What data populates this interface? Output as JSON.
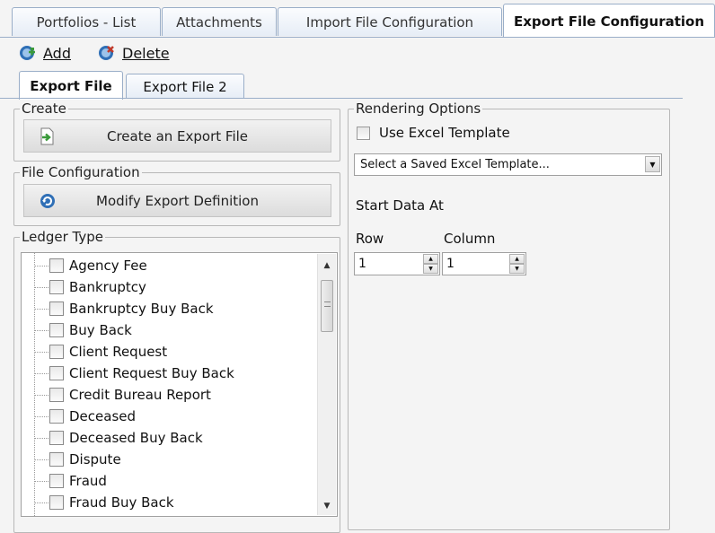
{
  "top_tabs": [
    {
      "label": "Portfolios - List"
    },
    {
      "label": "Attachments"
    },
    {
      "label": "Import File Configuration"
    },
    {
      "label": "Export File Configuration"
    }
  ],
  "toolbar": {
    "add_label": "Add",
    "delete_label": "Delete"
  },
  "sub_tabs": [
    {
      "label": "Export File"
    },
    {
      "label": "Export File 2"
    }
  ],
  "create": {
    "title": "Create",
    "button_label": "Create an Export File"
  },
  "file_configuration": {
    "title": "File Configuration",
    "button_label": "Modify Export Definition"
  },
  "ledger_type": {
    "title": "Ledger Type",
    "items": [
      "Agency Fee",
      "Bankruptcy",
      "Bankruptcy Buy Back",
      "Buy Back",
      "Client Request",
      "Client Request Buy Back",
      "Credit Bureau Report",
      "Deceased",
      "Deceased Buy Back",
      "Dispute",
      "Fraud",
      "Fraud Buy Back"
    ]
  },
  "rendering_options": {
    "title": "Rendering Options",
    "use_excel_template_label": "Use Excel Template",
    "excel_template_select": "Select a Saved Excel Template...",
    "start_data_at_label": "Start Data At",
    "row_label": "Row",
    "column_label": "Column",
    "row_value": "1",
    "column_value": "1"
  },
  "colors": {
    "tab_border": "#9aaec8",
    "icon_blue": "#2f6fb6",
    "icon_green": "#3a9a3a"
  }
}
